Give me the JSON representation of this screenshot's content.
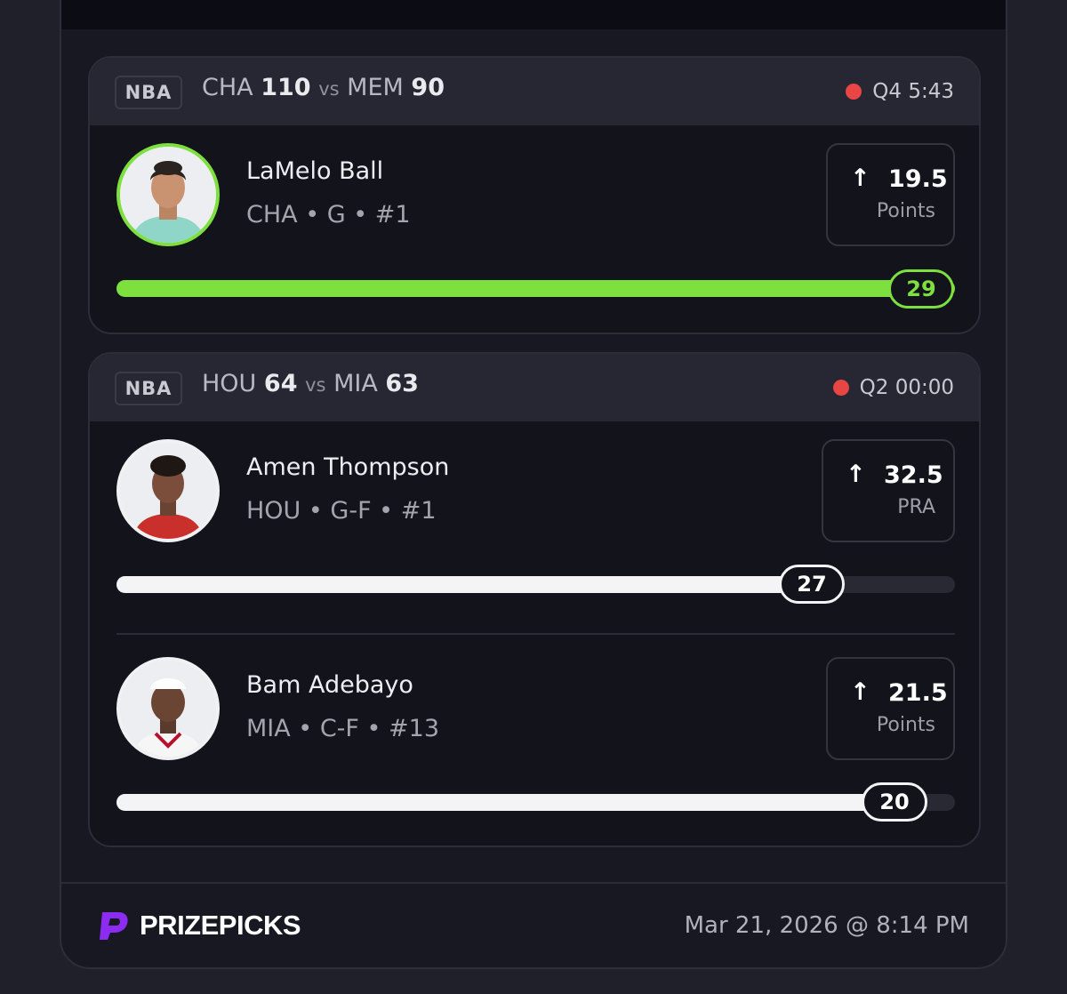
{
  "colors": {
    "accent_green": "#7de03e",
    "live_red": "#e84545",
    "bar_white": "#f4f4f6",
    "brand_purple": "#8b2cf0"
  },
  "games": [
    {
      "league": "NBA",
      "away_team": "CHA",
      "away_score": "110",
      "vs": "vs",
      "home_team": "MEM",
      "home_score": "90",
      "status": "Q4 5:43",
      "players": [
        {
          "name": "LaMelo Ball",
          "meta": "CHA • G • #1",
          "direction_icon": "arrow-up-icon",
          "line": "19.5",
          "stat": "Points",
          "current": "29",
          "progress_fraction": 1.0,
          "state": "hit"
        }
      ]
    },
    {
      "league": "NBA",
      "away_team": "HOU",
      "away_score": "64",
      "vs": "vs",
      "home_team": "MIA",
      "home_score": "63",
      "status": "Q2 00:00",
      "players": [
        {
          "name": "Amen Thompson",
          "meta": "HOU • G-F • #1",
          "direction_icon": "arrow-up-icon",
          "line": "32.5",
          "stat": "PRA",
          "current": "27",
          "progress_fraction": 0.83,
          "state": "in-progress"
        },
        {
          "name": "Bam Adebayo",
          "meta": "MIA • C-F • #13",
          "direction_icon": "arrow-up-icon",
          "line": "21.5",
          "stat": "Points",
          "current": "20",
          "progress_fraction": 0.93,
          "state": "in-progress"
        }
      ]
    }
  ],
  "footer": {
    "brand": "PRIZEPICKS",
    "timestamp": "Mar 21, 2026 @ 8:14 PM"
  }
}
